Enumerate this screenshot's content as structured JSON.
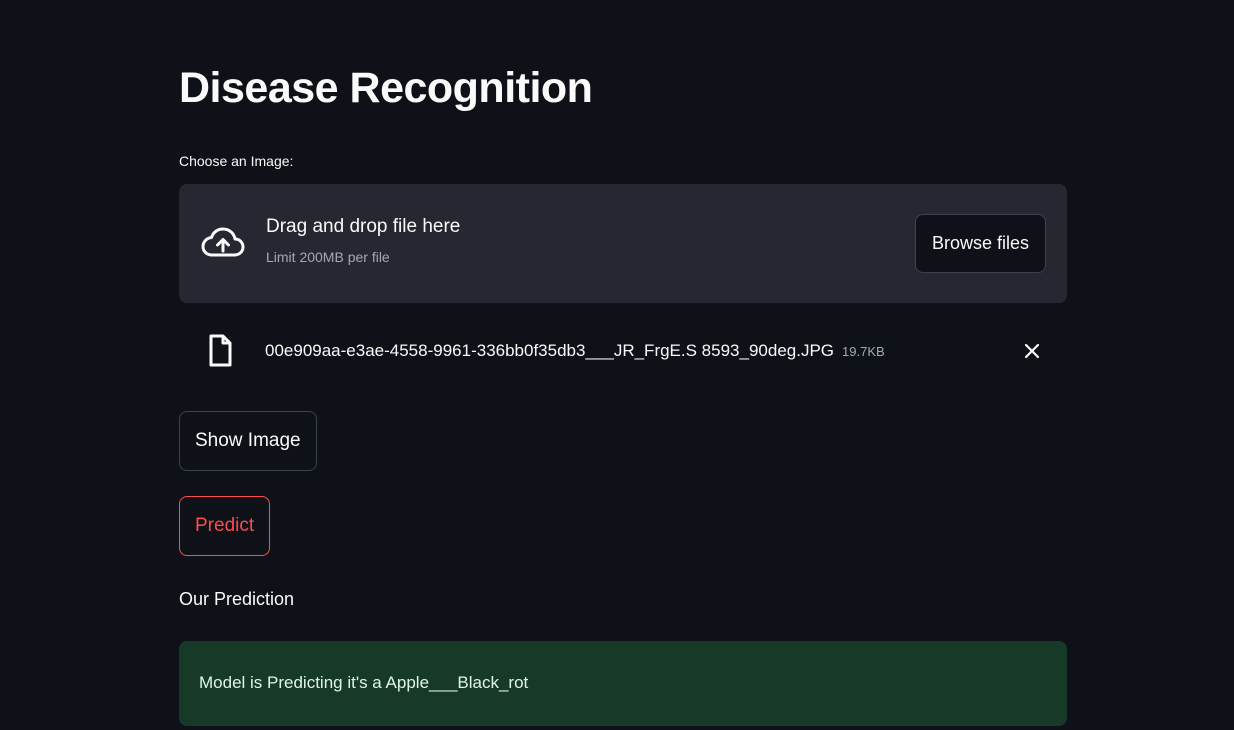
{
  "page": {
    "title": "Disease Recognition"
  },
  "uploader": {
    "label": "Choose an Image:",
    "drag_text": "Drag and drop file here",
    "limit_text": "Limit 200MB per file",
    "browse_label": "Browse files",
    "upload_icon": "cloud-upload-icon"
  },
  "file": {
    "name": "00e909aa-e3ae-4558-9961-336bb0f35db3___JR_FrgE.S 8593_90deg.JPG",
    "size": "19.7KB",
    "file_icon": "file-icon",
    "remove_icon": "close-icon"
  },
  "buttons": {
    "show_image": "Show Image",
    "predict": "Predict"
  },
  "prediction": {
    "heading": "Our Prediction",
    "result": "Model is Predicting it's a Apple___Black_rot"
  },
  "colors": {
    "background": "#0e1117",
    "dropzone": "#262730",
    "accent": "#ff4b4b",
    "success_bg": "#173928",
    "success_text": "#dff5e7"
  }
}
